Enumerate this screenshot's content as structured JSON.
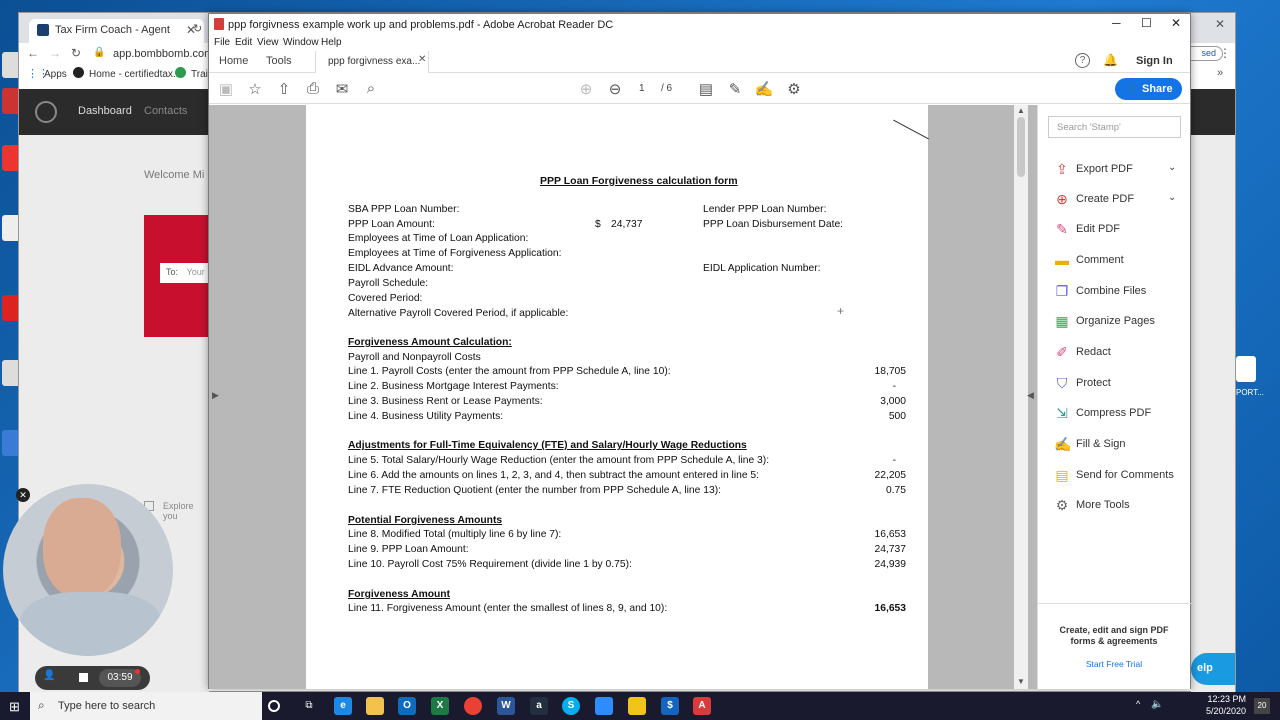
{
  "browser": {
    "tab_title": "Tax Firm Coach - Agent",
    "url": "app.bombbomb.com/a",
    "bookmarks": [
      "Apps",
      "Home - certifiedtax...",
      "Trai"
    ],
    "site_nav": [
      "Dashboard",
      "Contacts"
    ],
    "welcome": "Welcome Mi",
    "to_label": "To:",
    "to_placeholder": "Your",
    "explore": "Explore you",
    "right_badge": "sed",
    "help": "elp"
  },
  "acrobat": {
    "window_title": "ppp forgivness example work up and problems.pdf - Adobe Acrobat Reader DC",
    "menu": [
      "File",
      "Edit",
      "View",
      "Window",
      "Help"
    ],
    "home_tab": "Home",
    "tools_tab": "Tools",
    "doc_tab": "ppp forgivness exa...",
    "sign_in": "Sign In",
    "share": "Share",
    "page_current": "1",
    "page_total": "/ 6",
    "search_placeholder": "Search 'Stamp'",
    "tools": [
      {
        "label": "Export PDF",
        "icon": "export-pdf-icon",
        "color": "#d83b3b",
        "glyph": "⇪",
        "expand": true
      },
      {
        "label": "Create PDF",
        "icon": "create-pdf-icon",
        "color": "#d83b3b",
        "glyph": "⊕",
        "expand": true
      },
      {
        "label": "Edit PDF",
        "icon": "edit-pdf-icon",
        "color": "#e0457b",
        "glyph": "✎",
        "expand": false
      },
      {
        "label": "Comment",
        "icon": "comment-icon",
        "color": "#e9b300",
        "glyph": "▬",
        "expand": false
      },
      {
        "label": "Combine Files",
        "icon": "combine-files-icon",
        "color": "#5b5bd6",
        "glyph": "❐",
        "expand": false
      },
      {
        "label": "Organize Pages",
        "icon": "organize-pages-icon",
        "color": "#3aa657",
        "glyph": "▦",
        "expand": false
      },
      {
        "label": "Redact",
        "icon": "redact-icon",
        "color": "#e0457b",
        "glyph": "✐",
        "expand": false
      },
      {
        "label": "Protect",
        "icon": "protect-icon",
        "color": "#5b5bd6",
        "glyph": "⛉",
        "expand": false
      },
      {
        "label": "Compress PDF",
        "icon": "compress-pdf-icon",
        "color": "#2f9e8f",
        "glyph": "⇲",
        "expand": false
      },
      {
        "label": "Fill & Sign",
        "icon": "fill-sign-icon",
        "color": "#8a5bd6",
        "glyph": "✍",
        "expand": false
      },
      {
        "label": "Send for Comments",
        "icon": "send-comments-icon",
        "color": "#e9b300",
        "glyph": "▤",
        "expand": false
      },
      {
        "label": "More Tools",
        "icon": "more-tools-icon",
        "color": "#666666",
        "glyph": "⚙",
        "expand": false
      }
    ],
    "promo_text": "Create, edit and sign PDF forms & agreements",
    "promo_link": "Start Free Trial"
  },
  "document": {
    "title": "PPP Loan Forgiveness calculation form",
    "header_left": [
      "SBA PPP Loan Number:",
      "PPP Loan Amount:",
      "Employees at Time of Loan Application:",
      "Employees at Time of Forgiveness Application:",
      "EIDL Advance Amount:",
      "Payroll Schedule:",
      "Covered Period:",
      "Alternative Payroll Covered Period, if applicable:"
    ],
    "loan_amount_symbol": "$",
    "loan_amount": "24,737",
    "lender_number": "Lender PPP Loan Number:",
    "disbursement_date": "PPP Loan Disbursement Date:",
    "eidl_number": "EIDL Application Number:",
    "sec1_title": "Forgiveness Amount Calculation:",
    "sec1_sub": "Payroll and Nonpayroll Costs",
    "sec1_lines": [
      {
        "text": "Line 1. Payroll Costs (enter the amount from PPP Schedule A, line 10):",
        "value": "18,705"
      },
      {
        "text": "Line 2. Business Mortgage Interest Payments:",
        "value": "-"
      },
      {
        "text": "Line 3. Business Rent or Lease Payments:",
        "value": "3,000"
      },
      {
        "text": "Line 4. Business Utility Payments:",
        "value": "500"
      }
    ],
    "sec2_title": "Adjustments for Full-Time Equivalency (FTE) and Salary/Hourly Wage Reductions",
    "sec2_lines": [
      {
        "text": "Line 5. Total Salary/Hourly Wage Reduction (enter the amount from PPP Schedule A, line 3):",
        "value": "-"
      },
      {
        "text": "Line 6. Add the amounts on lines 1, 2, 3, and 4, then subtract the amount entered in line 5:",
        "value": "22,205"
      },
      {
        "text": "Line 7. FTE Reduction Quotient (enter the number from PPP Schedule A, line 13):",
        "value": "0.75"
      }
    ],
    "sec3_title": "Potential Forgiveness Amounts",
    "sec3_lines": [
      {
        "text": "Line 8. Modified Total (multiply line 6 by line 7):",
        "value": "16,653"
      },
      {
        "text": "Line 9. PPP Loan Amount:",
        "value": "24,737"
      },
      {
        "text": "Line 10. Payroll Cost 75% Requirement (divide line 1 by 0.75):",
        "value": "24,939"
      }
    ],
    "sec4_title": "Forgiveness Amount",
    "sec4_line": {
      "text": "Line 11. Forgiveness Amount (enter the smallest of lines 8, 9, and 10):",
      "value": "16,653"
    }
  },
  "recorder": {
    "time": "03:59"
  },
  "taskbar": {
    "search_placeholder": "Type here to search",
    "time": "12:23 PM",
    "date": "5/20/2020",
    "notif_count": "20"
  },
  "desktop": {
    "file_label": "PORT..."
  }
}
